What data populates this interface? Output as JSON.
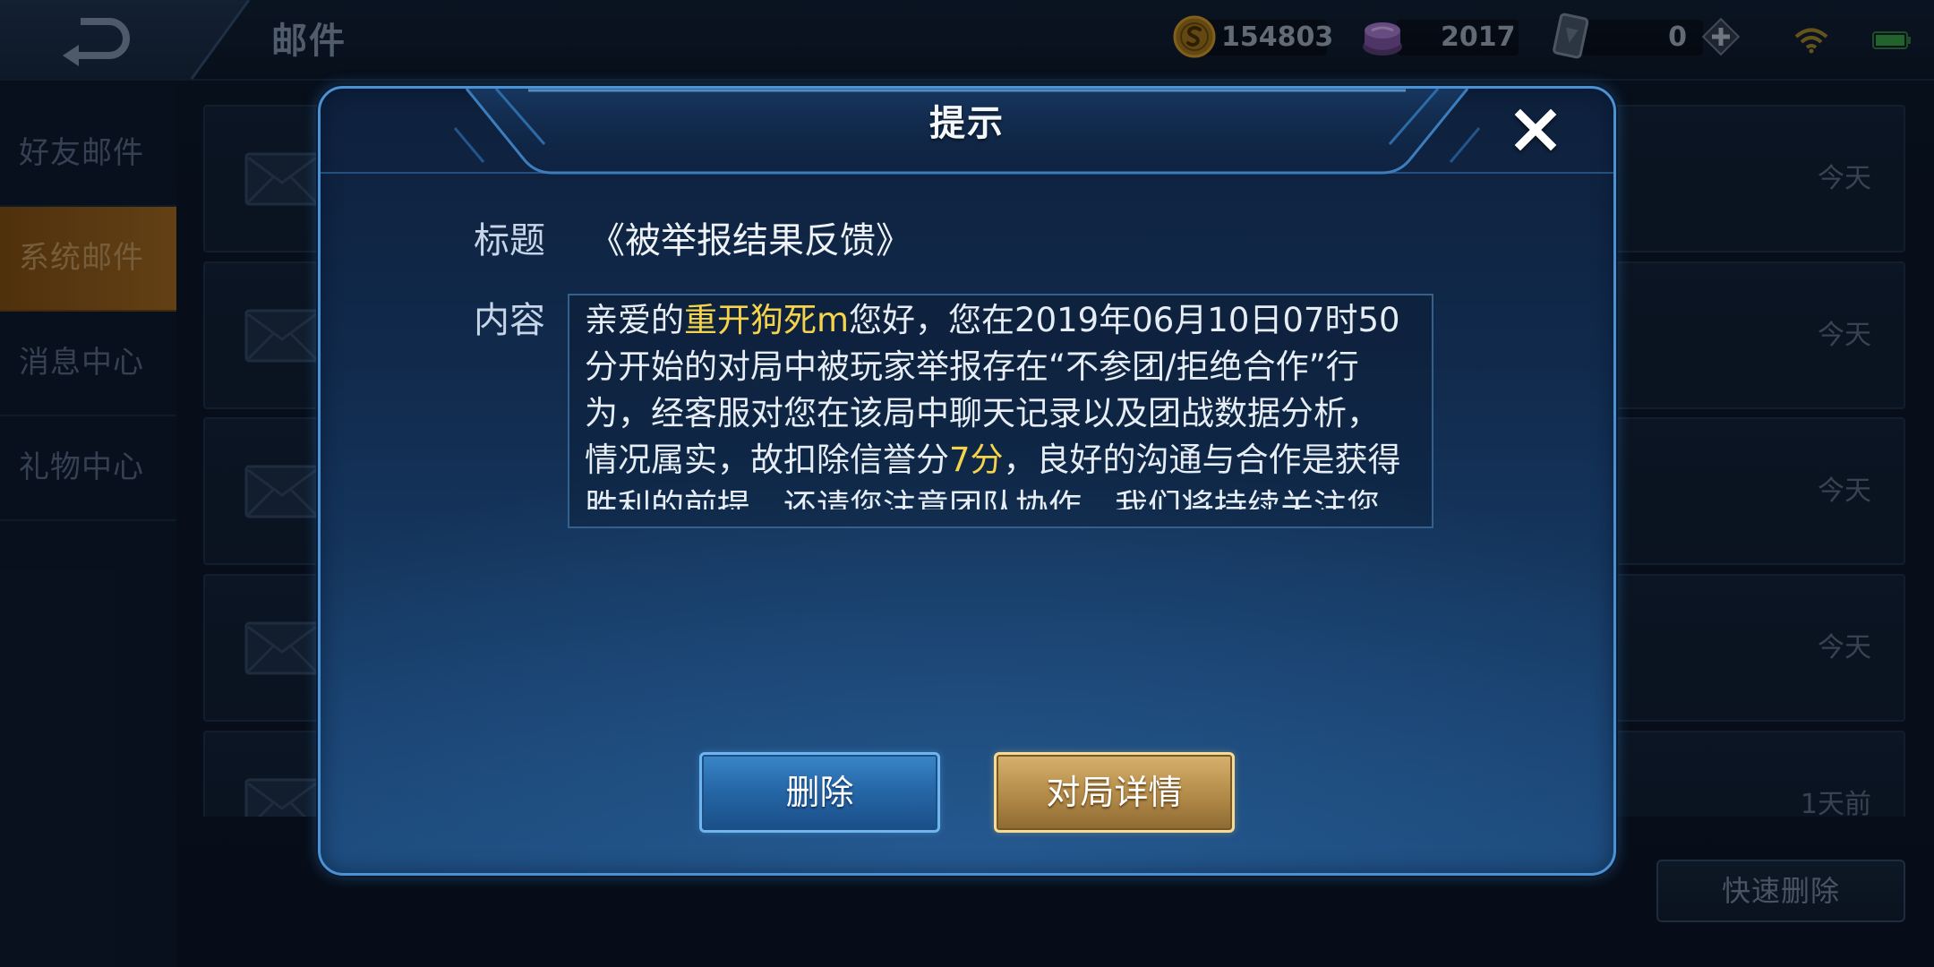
{
  "topbar": {
    "title": "邮件",
    "back_icon": "back-arrow-icon",
    "resources": [
      {
        "icon": "gold-coin-icon",
        "value": "154803"
      },
      {
        "icon": "diamond-gem-icon",
        "value": "2017"
      },
      {
        "icon": "card-ticket-icon",
        "value": "0"
      }
    ],
    "add_icon": "plus-icon",
    "status_icons": [
      "wifi-icon",
      "battery-icon"
    ]
  },
  "sidebar": {
    "items": [
      {
        "label": "好友邮件",
        "selected": false
      },
      {
        "label": "系统邮件",
        "selected": true
      },
      {
        "label": "消息中心",
        "selected": false
      },
      {
        "label": "礼物中心",
        "selected": false
      }
    ]
  },
  "mail_list": {
    "row_icon": "envelope-icon",
    "rows": [
      {
        "time": "今天"
      },
      {
        "time": "今天"
      },
      {
        "time": "今天"
      },
      {
        "time": "今天"
      },
      {
        "time": "1天前"
      }
    ],
    "quick_delete_label": "快速删除"
  },
  "dialog": {
    "title": "提示",
    "close_icon": "close-icon",
    "subject_label": "标题",
    "subject": "《被举报结果反馈》",
    "content_label": "内容",
    "content": {
      "lines": [
        [
          {
            "text": "亲爱的"
          },
          {
            "text": "重开狗死m",
            "highlight": true
          },
          {
            "text": "您好，您在2019年06月10日07时50"
          }
        ],
        [
          {
            "text": "分开始的对局中被玩家举报存在“不参团/拒绝合作”行"
          }
        ],
        [
          {
            "text": "为，经客服对您在该局中聊天记录以及团战数据分析，"
          }
        ],
        [
          {
            "text": "情况属实，故扣除信誉分"
          },
          {
            "text": "7分",
            "highlight": true
          },
          {
            "text": "，良好的沟通与合作是获得"
          }
        ],
        [
          {
            "text": "胜利的前提，还请您注意团队协作，我们将持续关注您"
          }
        ]
      ]
    },
    "buttons": {
      "delete": "删除",
      "match_details": "对局详情"
    }
  },
  "colors": {
    "dialog_border": "#4a92d4",
    "highlight_text": "#f6d44a",
    "selected_tab": "#8a5a1e",
    "delete_button": "#2566a6",
    "details_button": "#b68d4a"
  }
}
